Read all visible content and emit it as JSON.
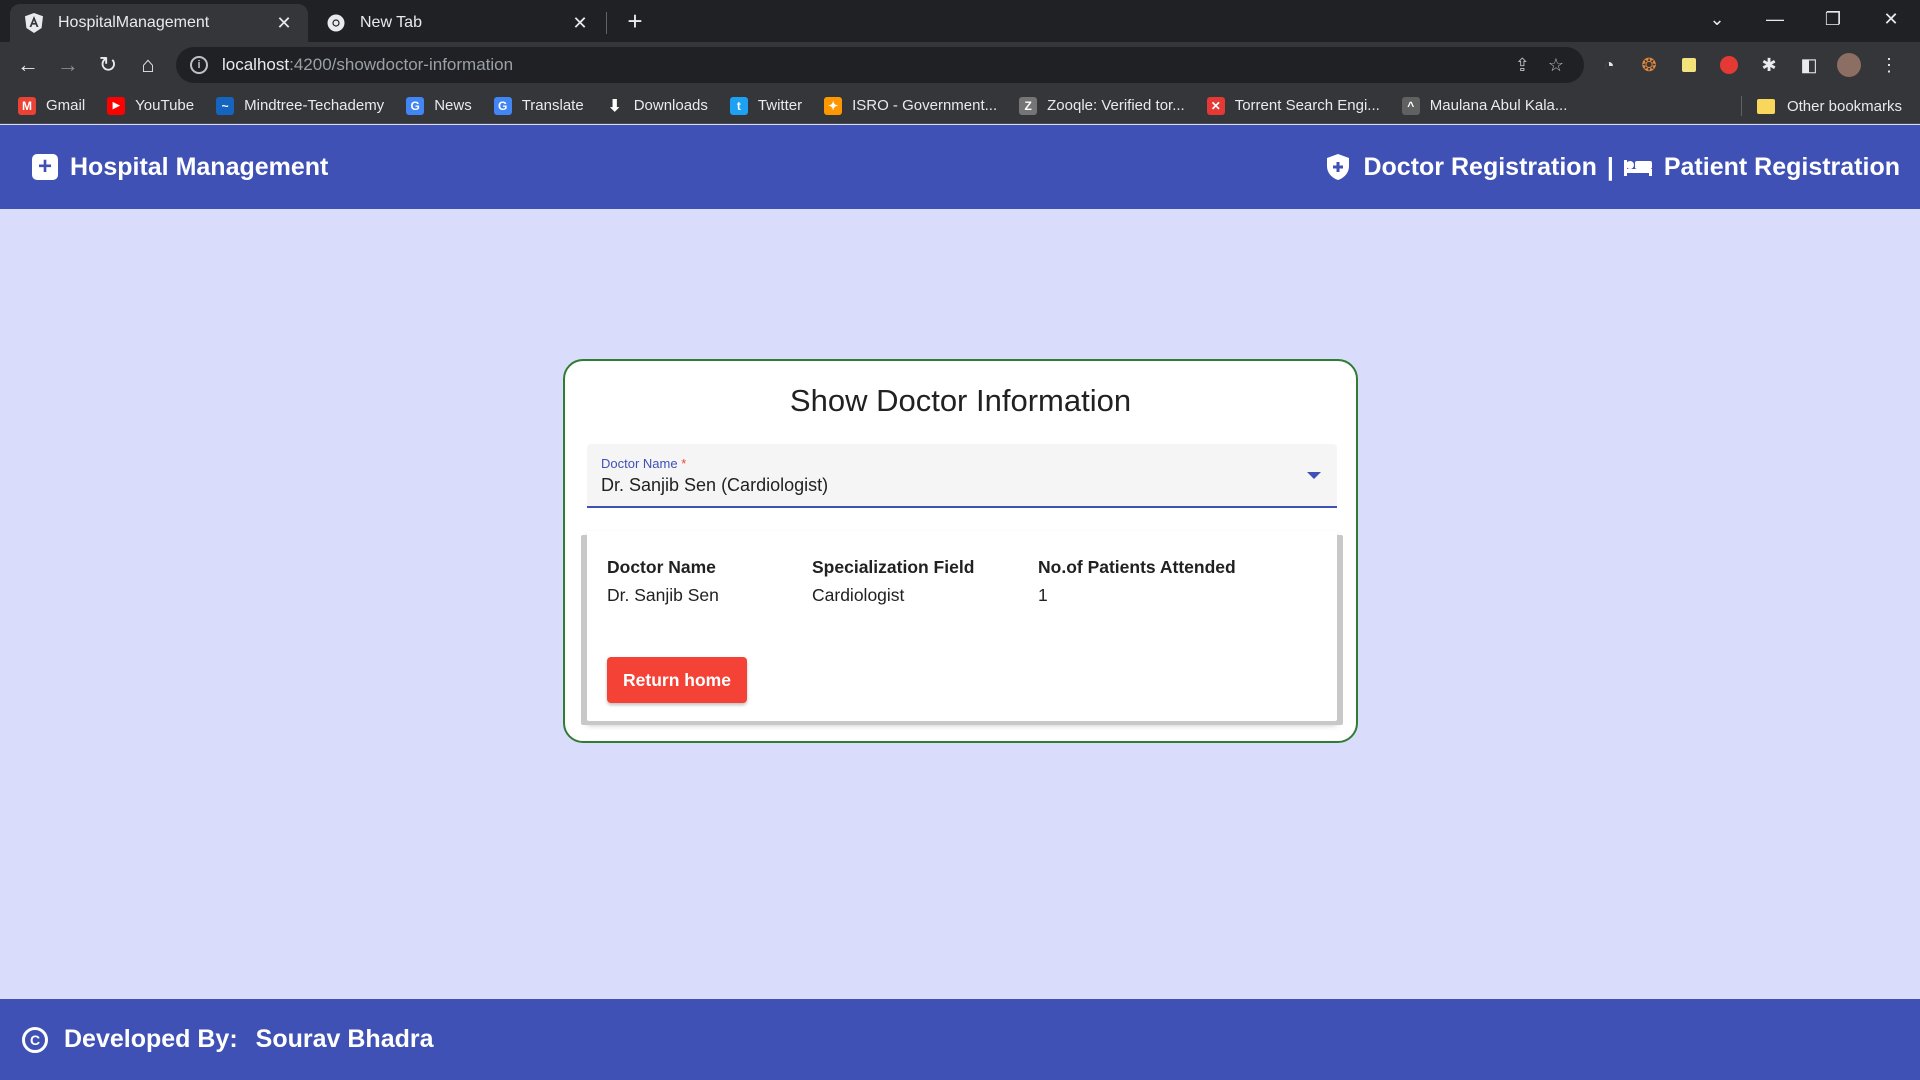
{
  "browser": {
    "tabs": [
      {
        "title": "HospitalManagement",
        "active": true
      },
      {
        "title": "New Tab",
        "active": false
      }
    ],
    "url": {
      "host": "localhost",
      "path": ":4200/showdoctor-information"
    },
    "bookmarks": [
      {
        "label": "Gmail",
        "icon": "gmail-icon",
        "color": "#ea4335",
        "glyph": "M"
      },
      {
        "label": "YouTube",
        "icon": "youtube-icon",
        "color": "#ff0000",
        "glyph": "▶"
      },
      {
        "label": "Mindtree-Techademy",
        "icon": "mindtree-icon",
        "color": "#1565c0",
        "glyph": "~"
      },
      {
        "label": "News",
        "icon": "google-news-icon",
        "color": "#4285f4",
        "glyph": "G"
      },
      {
        "label": "Translate",
        "icon": "google-translate-icon",
        "color": "#4285f4",
        "glyph": "G"
      },
      {
        "label": "Downloads",
        "icon": "download-icon",
        "color": "#35363a",
        "glyph": "⬇"
      },
      {
        "label": "Twitter",
        "icon": "twitter-icon",
        "color": "#1da1f2",
        "glyph": "t"
      },
      {
        "label": "ISRO - Government...",
        "icon": "isro-icon",
        "color": "#ff9800",
        "glyph": "✦"
      },
      {
        "label": "Zooqle: Verified tor...",
        "icon": "zooqle-icon",
        "color": "#757575",
        "glyph": "Z"
      },
      {
        "label": "Torrent Search Engi...",
        "icon": "torrent-icon",
        "color": "#e53935",
        "glyph": "✕"
      },
      {
        "label": "Maulana Abul Kala...",
        "icon": "graduation-cap-icon",
        "color": "#616161",
        "glyph": "🎓"
      }
    ],
    "other_bookmarks": "Other bookmarks"
  },
  "header": {
    "title": "Hospital Management",
    "nav": {
      "doctor_registration": "Doctor Registration",
      "separator": "|",
      "patient_registration": "Patient Registration"
    }
  },
  "card": {
    "title": "Show Doctor Information",
    "select": {
      "label": "Doctor Name",
      "required_mark": "*",
      "value": "Dr. Sanjib Sen (Cardiologist)"
    },
    "table": {
      "headers": [
        "Doctor Name",
        "Specialization Field",
        "No.of Patients Attended"
      ],
      "values": [
        "Dr. Sanjib Sen",
        "Cardiologist",
        "1"
      ]
    },
    "return_button": "Return home"
  },
  "footer": {
    "label": "Developed By:",
    "name": "Sourav Bhadra"
  },
  "colors": {
    "primary": "#3f51b5",
    "background": "#dadcfb",
    "card_border": "#2e7d32",
    "button": "#f44336"
  }
}
